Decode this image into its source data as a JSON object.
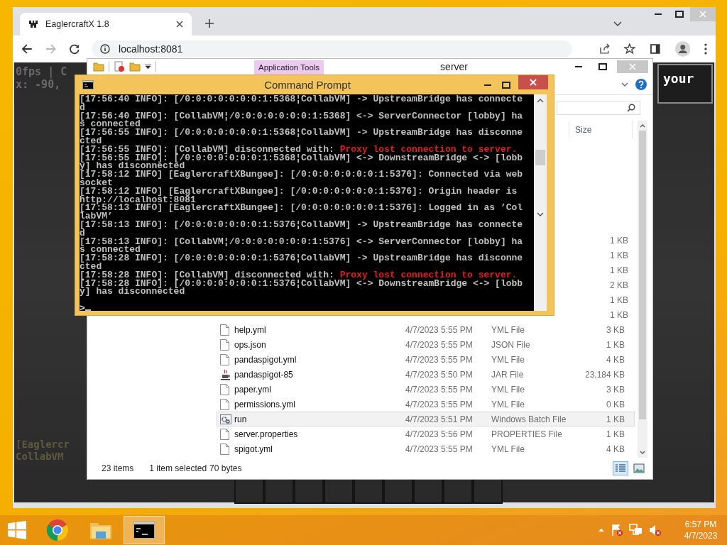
{
  "browser": {
    "tabs": [
      {
        "title": "EaglercraftX 1.8",
        "selected": true
      }
    ],
    "nav": [
      {
        "kind": "back",
        "disabled": false
      },
      {
        "kind": "forward",
        "disabled": true
      },
      {
        "kind": "reload",
        "disabled": false
      }
    ],
    "address": "localhost:8081"
  },
  "game": {
    "debug_lines": [
      "0fps | C",
      "x: -90,"
    ],
    "button": "your",
    "chat_lines": [
      "[Eaglercr",
      "CollabVM"
    ]
  },
  "explorer": {
    "context_tab": "Application Tools",
    "title": "server",
    "size_header": "Size",
    "rows": [
      {
        "size": "1 KB",
        "selected": false
      },
      {
        "size": "1 KB",
        "selected": false
      },
      {
        "size": "1 KB",
        "selected": false
      },
      {
        "size": "2 KB",
        "selected": false
      },
      {
        "size": "1 KB",
        "selected": false
      },
      {
        "size": "1 KB",
        "selected": false
      },
      {
        "kind": "document",
        "name": "help.yml",
        "date": "4/7/2023 5:55 PM",
        "type": "YML File",
        "size": "3 KB",
        "selected": false
      },
      {
        "kind": "document",
        "name": "ops.json",
        "date": "4/7/2023 5:55 PM",
        "type": "JSON File",
        "size": "1 KB",
        "selected": false
      },
      {
        "kind": "document",
        "name": "pandaspigot.yml",
        "date": "4/7/2023 5:55 PM",
        "type": "YML File",
        "size": "4 KB",
        "selected": false
      },
      {
        "kind": "jar",
        "name": "pandaspigot-85",
        "date": "4/7/2023 5:50 PM",
        "type": "JAR File",
        "size": "23,184 KB",
        "selected": false
      },
      {
        "kind": "document",
        "name": "paper.yml",
        "date": "4/7/2023 5:55 PM",
        "type": "YML File",
        "size": "3 KB",
        "selected": false
      },
      {
        "kind": "document",
        "name": "permissions.yml",
        "date": "4/7/2023 5:55 PM",
        "type": "YML File",
        "size": "0 KB",
        "selected": false
      },
      {
        "kind": "batch",
        "name": "run",
        "date": "4/7/2023 5:51 PM",
        "type": "Windows Batch File",
        "size": "1 KB",
        "selected": true
      },
      {
        "kind": "document",
        "name": "server.properties",
        "date": "4/7/2023 5:56 PM",
        "type": "PROPERTIES File",
        "size": "1 KB",
        "selected": false
      },
      {
        "kind": "document",
        "name": "spigot.yml",
        "date": "4/7/2023 5:55 PM",
        "type": "YML File",
        "size": "4 KB",
        "selected": false
      }
    ],
    "status": {
      "count": "23 items",
      "selection": "1 item selected",
      "selection_size": "70 bytes"
    }
  },
  "console": {
    "title": "Command Prompt",
    "lines": [
      {
        "text": "[17:56:40 INFO]: [/0:0:0:0:0:0:0:1:5368¦CollabVM] -> UpstreamBridge has connecte"
      },
      {
        "text": "d"
      },
      {
        "text": "[17:56:40 INFO]: [CollabVM¦/0:0:0:0:0:0:0:1:5368] <-> ServerConnector [lobby] ha"
      },
      {
        "text": "s connected"
      },
      {
        "text": "[17:56:55 INFO]: [/0:0:0:0:0:0:0:1:5368¦CollabVM] -> UpstreamBridge has disconne"
      },
      {
        "text": "cted"
      },
      {
        "text": "[17:56:55 INFO]: [CollabVM] disconnected with: ",
        "alert": "Proxy lost connection to server."
      },
      {
        "text": "[17:56:55 INFO]: [/0:0:0:0:0:0:0:1:5368¦CollabVM] <-> DownstreamBridge <-> [lobb"
      },
      {
        "text": "y] has disconnected"
      },
      {
        "text": "[17:58:12 INFO] [EaglercraftXBungee]: [/0:0:0:0:0:0:0:1:5376]: Connected via web"
      },
      {
        "text": "socket"
      },
      {
        "text": "[17:58:12 INFO] [EaglercraftXBungee]: [/0:0:0:0:0:0:0:1:5376]: Origin header is"
      },
      {
        "text": "http://localhost:8081"
      },
      {
        "text": "[17:58:13 INFO] [EaglercraftXBungee]: [/0:0:0:0:0:0:0:1:5376]: Logged in as ’Col"
      },
      {
        "text": "labVM’"
      },
      {
        "text": "[17:58:13 INFO]: [/0:0:0:0:0:0:0:1:5376¦CollabVM] -> UpstreamBridge has connecte"
      },
      {
        "text": "d"
      },
      {
        "text": "[17:58:13 INFO]: [CollabVM¦/0:0:0:0:0:0:0:1:5376] <-> ServerConnector [lobby] ha"
      },
      {
        "text": "s connected"
      },
      {
        "text": "[17:58:28 INFO]: [/0:0:0:0:0:0:0:1:5376¦CollabVM] -> UpstreamBridge has disconne"
      },
      {
        "text": "cted"
      },
      {
        "text": "[17:58:28 INFO]: [CollabVM] disconnected with: ",
        "alert": "Proxy lost connection to server."
      },
      {
        "text": "[17:58:28 INFO]: [/0:0:0:0:0:0:0:1:5376¦CollabVM] <-> DownstreamBridge <-> [lobb"
      },
      {
        "text": "y] has disconnected"
      }
    ],
    "prompt": ">"
  },
  "taskbar": {
    "apps": [
      {
        "kind": "browser",
        "selected": false
      },
      {
        "kind": "files",
        "selected": false
      },
      {
        "kind": "terminal",
        "selected": true
      }
    ],
    "clock": {
      "time": "6:57 PM",
      "date": "4/7/2023"
    }
  }
}
